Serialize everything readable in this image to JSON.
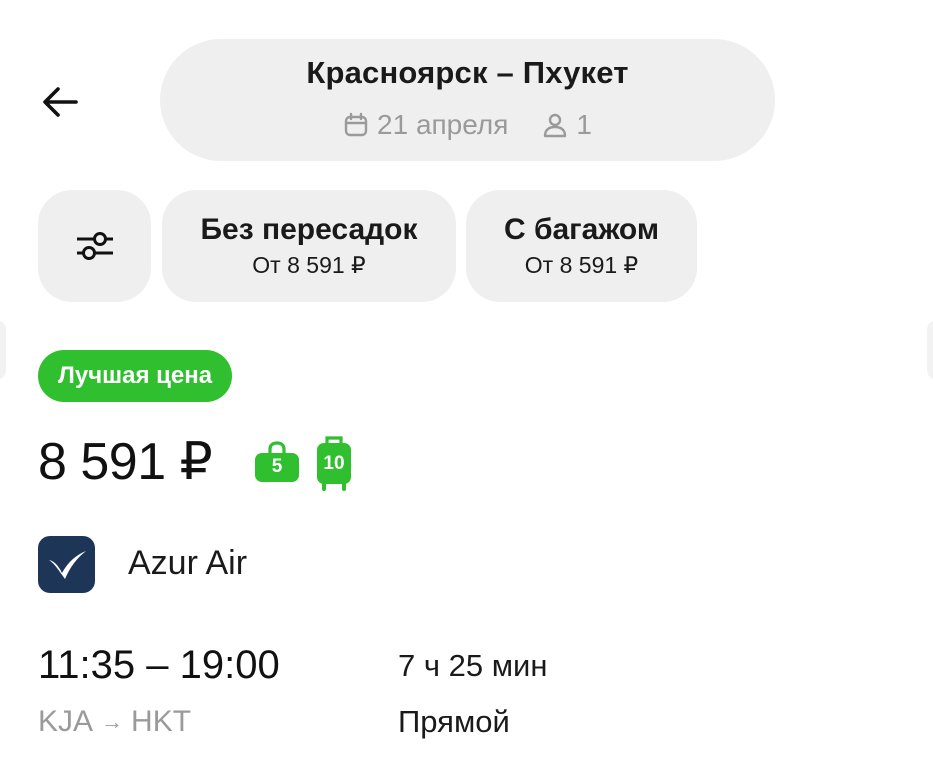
{
  "header": {
    "route": "Красноярск – Пхукет",
    "date": "21 апреля",
    "passengers": "1"
  },
  "filters": {
    "settings_icon": "sliders-icon",
    "chips": [
      {
        "label": "Без пересадок",
        "price": "От 8 591 ₽"
      },
      {
        "label": "С багажом",
        "price": "От 8 591 ₽"
      }
    ]
  },
  "result": {
    "badge": "Лучшая цена",
    "price": "8 591 ₽",
    "hand_baggage_kg": "5",
    "checked_baggage_kg": "10",
    "airline": "Azur Air",
    "times": "11:35 – 19:00",
    "from": "KJA",
    "arrow": "→",
    "to": "HKT",
    "duration": "7 ч 25 мин",
    "stops": "Прямой"
  },
  "colors": {
    "accent_green": "#2fbf2f",
    "chip_bg": "#efefef",
    "muted_text": "#9a9a9a",
    "airline_logo_bg": "#1d3557"
  }
}
